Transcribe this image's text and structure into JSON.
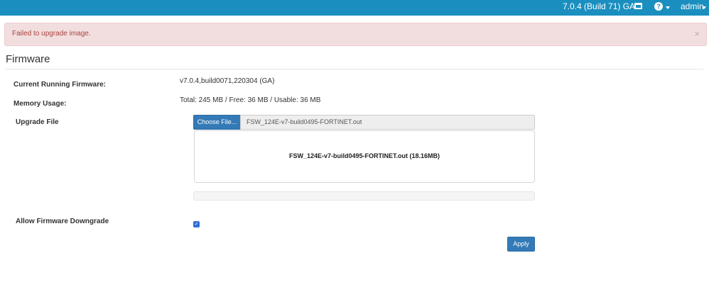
{
  "topbar": {
    "version": "7.0.4 (Build 71) GA",
    "dashboard_icon": "monitor-icon",
    "help_icon": "question-circle-icon",
    "user": "admin"
  },
  "alert": {
    "message": "Failed to upgrade image.",
    "close": "×"
  },
  "page": {
    "title": "Firmware"
  },
  "fields": {
    "current_running_label": "Current Running Firmware:",
    "current_running_value": "v7.0.4,build0071,220304 (GA)",
    "memory_label": "Memory Usage:",
    "memory_value": "Total: 245 MB / Free: 36 MB / Usable: 36 MB",
    "upgrade_label": "Upgrade File",
    "choose_button": "Choose File...",
    "file_name": "FSW_124E-v7-build0495-FORTINET.out",
    "dropzone_file": "FSW_124E-v7-build0495-FORTINET.out (18.16MB)",
    "progress": 0,
    "downgrade_label": "Allow Firmware Downgrade",
    "downgrade_checked": true,
    "checkmark": "✓",
    "apply_button": "Apply"
  }
}
